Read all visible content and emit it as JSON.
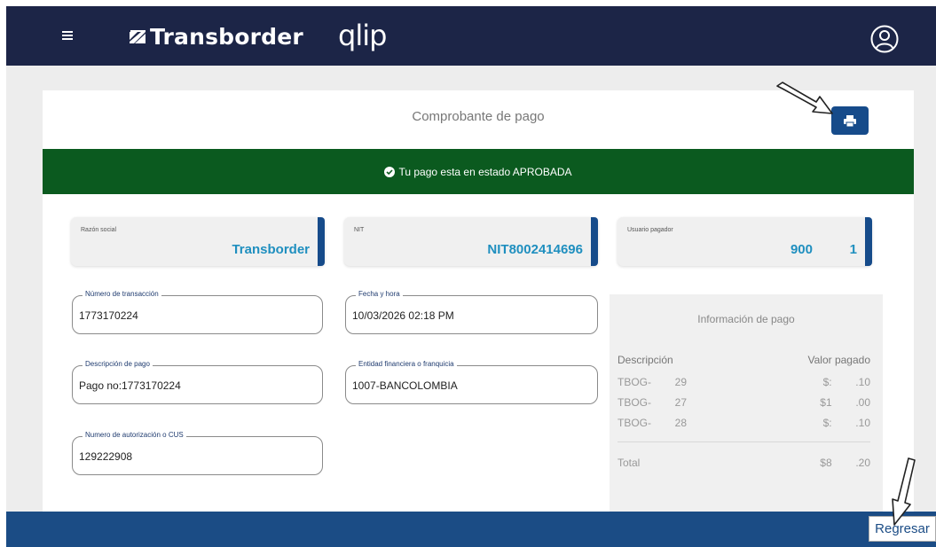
{
  "header": {
    "brand": "Transborder",
    "product": "qlip",
    "menu_icon": "hamburger-icon",
    "user_icon": "user-circle-icon"
  },
  "receipt": {
    "title": "Comprobante de pago",
    "print_icon": "print-icon",
    "status_text": "Tu pago esta en estado APROBADA",
    "status_icon": "check-circle-icon"
  },
  "summary": {
    "razon_social_label": "Razón social",
    "razon_social_value": "Transborder",
    "nit_label": "NIT",
    "nit_value": "NIT8002414696",
    "usuario_label": "Usuario pagador",
    "usuario_value": "900          1"
  },
  "fields": {
    "transaccion_label": "Número de transacción",
    "transaccion_value": "1773170224",
    "fecha_label": "Fecha y hora",
    "fecha_value": "10/03/2026 02:18 PM",
    "descripcion_label": "Descripción de pago",
    "descripcion_value": "Pago no:1773170224",
    "entidad_label": "Entidad financiera o franquicia",
    "entidad_value": "1007-BANCOLOMBIA",
    "autorizacion_label": "Numero de autorización o CUS",
    "autorizacion_value": "129222908"
  },
  "payment_info": {
    "title": "Información de pago",
    "col_desc": "Descripción",
    "col_valor": "Valor pagado",
    "rows": [
      {
        "desc": "TBOG-        29",
        "valor": "$:        .10"
      },
      {
        "desc": "TBOG-        27",
        "valor": "$1        .00"
      },
      {
        "desc": "TBOG-        28",
        "valor": "$:        .10"
      }
    ],
    "total_label": "Total",
    "total_value": "$8        .20"
  },
  "footer": {
    "back_label": "Regresar"
  },
  "colors": {
    "topbar": "#1c2547",
    "accent_blue": "#164b8a",
    "success_green": "#0b5a1f",
    "value_blue": "#1f8fbf"
  }
}
